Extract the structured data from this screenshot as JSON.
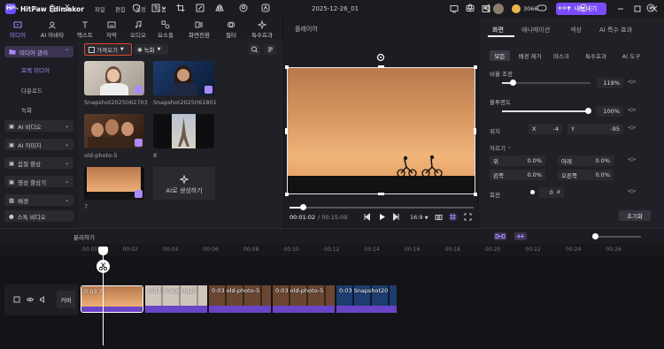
{
  "titlebar": {
    "app_name": "HitPaw Edimakor",
    "logo_text": "HP",
    "menus": [
      "파일",
      "편집",
      "설정",
      "도움"
    ],
    "project_name": "2025-12-26_01",
    "credits": "3066",
    "export_label": "내보내기"
  },
  "toolbar": {
    "tools": [
      {
        "label": "미디어",
        "icon": "media-icon",
        "active": true
      },
      {
        "label": "AI 아바타",
        "icon": "avatar-icon"
      },
      {
        "label": "텍스트",
        "icon": "text-icon"
      },
      {
        "label": "자막",
        "icon": "subtitle-icon"
      },
      {
        "label": "오디오",
        "icon": "audio-icon"
      },
      {
        "label": "요소들",
        "icon": "elements-icon"
      },
      {
        "label": "화면전환",
        "icon": "transition-icon"
      },
      {
        "label": "필터",
        "icon": "filter-icon"
      },
      {
        "label": "특수효과",
        "icon": "effects-icon"
      }
    ]
  },
  "sidebar": {
    "group_label": "미디어 관리",
    "sub_items": [
      "프젝 미디어",
      "다운로드",
      "녹화"
    ],
    "items": [
      "AI 비디오",
      "AI 이미지",
      "음질 향상",
      "영상 향상기",
      "배경",
      "스톡 비디오"
    ]
  },
  "media": {
    "import_label": "가져오기",
    "record_label": "녹화",
    "thumbs": [
      {
        "caption": "Snapshot2025062703"
      },
      {
        "caption": "Snapshot2025061801"
      },
      {
        "caption": "old-photo-5"
      },
      {
        "caption": "8"
      },
      {
        "caption": "7"
      }
    ],
    "ai_card_label": "AI로 생성하기"
  },
  "player": {
    "title": "플레이어",
    "current_time": "00:01:02",
    "total_time": "/ 00:15:00",
    "aspect_ratio": "16:9",
    "progress_fraction": 0.07
  },
  "right_panel": {
    "tabs": [
      "화면",
      "애니메이션",
      "색상",
      "AI 특수 효과"
    ],
    "sub_tabs": [
      "모든",
      "배경 제거",
      "마스크",
      "특수효과",
      "AI 도구"
    ],
    "scale_label": "비율 조정",
    "scale_value": "119%",
    "opacity_label": "불투명도",
    "opacity_value": "100%",
    "position_label": "위치",
    "pos_x_label": "X",
    "pos_x": "-4",
    "pos_y_label": "Y",
    "pos_y": "-95",
    "crop_label": "자르기",
    "crop_top_label": "위",
    "crop_top": "0.0%",
    "crop_bottom_label": "아래",
    "crop_bottom": "0.0%",
    "crop_left_label": "왼쪽",
    "crop_left": "0.0%",
    "crop_right_label": "오른쪽",
    "crop_right": "0.0%",
    "rotate_label": "회전",
    "rotate_value": "0",
    "reset_label": "초기화"
  },
  "timeline": {
    "split_label": "분리하기",
    "ruler_ticks": [
      "00:00",
      "00:02",
      "00:04",
      "00:06",
      "00:08",
      "00:10",
      "00:12",
      "00:14",
      "00:16",
      "00:18",
      "00:20",
      "00:22",
      "00:24",
      "00:26"
    ],
    "cover_label": "커버",
    "clips": [
      {
        "label": "0:03  7"
      },
      {
        "label": "0:03  Snapshot20"
      },
      {
        "label": "0:03  old-photo-5"
      },
      {
        "label": "0:03  old-photo-5"
      },
      {
        "label": "0:03  Snapshot20"
      }
    ]
  },
  "colors": {
    "accent": "#7b4cff",
    "highlight_border": "#e0452c"
  }
}
